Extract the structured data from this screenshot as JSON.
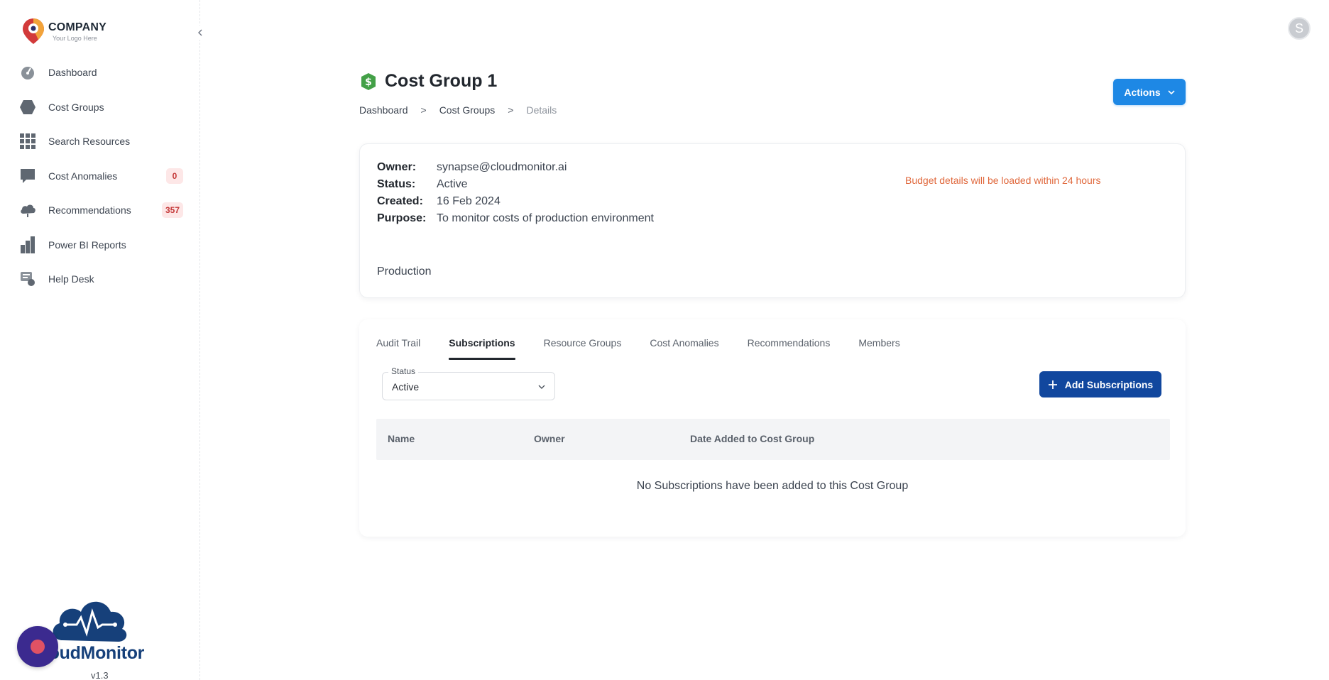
{
  "brand": {
    "company": "COMPANY",
    "tagline": "Your Logo Here",
    "product_name": "loudMonitor",
    "version": "v1.3"
  },
  "sidebar": {
    "items": [
      {
        "label": "Dashboard",
        "icon": "dashboard-icon"
      },
      {
        "label": "Cost Groups",
        "icon": "hexagon-icon"
      },
      {
        "label": "Search Resources",
        "icon": "grid-icon"
      },
      {
        "label": "Cost Anomalies",
        "icon": "chat-icon",
        "badge": "0"
      },
      {
        "label": "Recommendations",
        "icon": "cloud-icon",
        "badge": "357"
      },
      {
        "label": "Power BI Reports",
        "icon": "bar-chart-icon"
      },
      {
        "label": "Help Desk",
        "icon": "help-desk-icon"
      }
    ]
  },
  "user": {
    "avatar_initial": "S"
  },
  "page": {
    "title": "Cost Group 1",
    "actions_label": "Actions",
    "breadcrumb": [
      "Dashboard",
      "Cost Groups",
      "Details"
    ],
    "breadcrumb_sep": ">"
  },
  "details": {
    "owner_key": "Owner:",
    "owner": "synapse@cloudmonitor.ai",
    "status_key": "Status:",
    "status": "Active",
    "created_key": "Created:",
    "created": "16 Feb 2024",
    "purpose_key": "Purpose:",
    "purpose": "To monitor costs of production environment",
    "budget_note": "Budget details will be loaded within 24 hours",
    "tag": "Production"
  },
  "tabs": [
    "Audit Trail",
    "Subscriptions",
    "Resource Groups",
    "Cost Anomalies",
    "Recommendations",
    "Members"
  ],
  "active_tab": "Subscriptions",
  "filter": {
    "label": "Status",
    "value": "Active"
  },
  "add_button_label": "Add Subscriptions",
  "table": {
    "columns": [
      "Name",
      "Owner",
      "Date Added to Cost Group"
    ],
    "empty_message": "No Subscriptions have been added to this Cost Group"
  },
  "colors": {
    "primary": "#1e88e5",
    "dark_button": "#11479e",
    "badge_bg": "#fde7e7",
    "badge_text": "#c53a3a",
    "warning_text": "#e0683c",
    "title_icon": "#43a047"
  }
}
